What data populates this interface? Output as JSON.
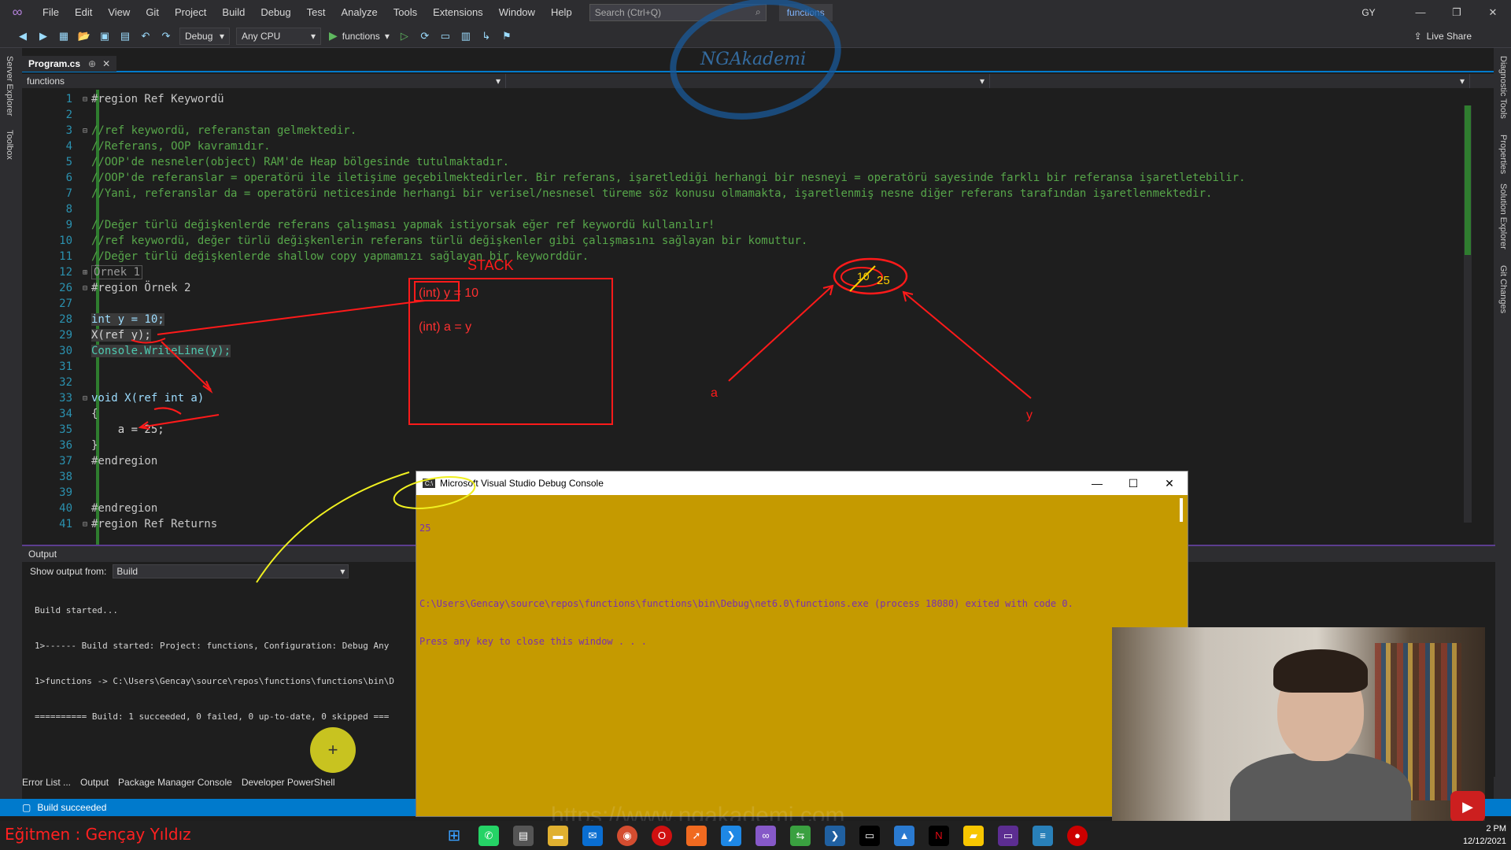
{
  "menubar": {
    "items": [
      "File",
      "Edit",
      "View",
      "Git",
      "Project",
      "Build",
      "Debug",
      "Test",
      "Analyze",
      "Tools",
      "Extensions",
      "Window",
      "Help"
    ],
    "search_placeholder": "Search (Ctrl+Q)",
    "solution_name": "functions",
    "user_initials": "GY"
  },
  "toolbar": {
    "config": "Debug",
    "platform": "Any CPU",
    "run_target": "functions",
    "live_share": "Live Share"
  },
  "side_tabs": {
    "left": [
      "Server Explorer",
      "Toolbox"
    ],
    "right": [
      "Diagnostic Tools",
      "Properties",
      "Solution Explorer",
      "Git Changes"
    ]
  },
  "document": {
    "tab_name": "Program.cs",
    "nav_scope": "functions"
  },
  "code_lines": [
    {
      "n": "1",
      "text": "#region Ref Keywordü",
      "kind": "region"
    },
    {
      "n": "2",
      "text": "",
      "kind": "plain"
    },
    {
      "n": "3",
      "text": "//ref keywordü, referanstan gelmektedir.",
      "kind": "comment"
    },
    {
      "n": "4",
      "text": "//Referans, OOP kavramıdır.",
      "kind": "comment"
    },
    {
      "n": "5",
      "text": "//OOP'de nesneler(object) RAM'de Heap bölgesinde tutulmaktadır.",
      "kind": "comment"
    },
    {
      "n": "6",
      "text": "//OOP'de referanslar = operatörü ile iletişime geçebilmektedirler. Bir referans, işaretlediği herhangi bir nesneyi = operatörü sayesinde farklı bir referansa işaretletebilir.",
      "kind": "comment"
    },
    {
      "n": "7",
      "text": "//Yani, referanslar da = operatörü neticesinde herhangi bir verisel/nesnesel türeme söz konusu olmamakta, işaretlenmiş nesne diğer referans tarafından işaretlenmektedir.",
      "kind": "comment"
    },
    {
      "n": "8",
      "text": "",
      "kind": "plain"
    },
    {
      "n": "9",
      "text": "//Değer türlü değişkenlerde referans çalışması yapmak istiyorsak eğer ref keywordü kullanılır!",
      "kind": "comment"
    },
    {
      "n": "10",
      "text": "//ref keywordü, değer türlü değişkenlerin referans türlü değişkenler gibi çalışmasını sağlayan bir komuttur.",
      "kind": "comment"
    },
    {
      "n": "11",
      "text": "//Değer türlü değişkenlerde shallow copy yapmamızı sağlayan bir keyworddür.",
      "kind": "comment"
    },
    {
      "n": "12",
      "text": "Örnek 1",
      "kind": "collapsed"
    },
    {
      "n": "26",
      "text": "#region Örnek 2",
      "kind": "region"
    },
    {
      "n": "27",
      "text": "",
      "kind": "plain"
    },
    {
      "n": "28",
      "text": "int y = 10;",
      "kind": "code-int"
    },
    {
      "n": "29",
      "text": "X(ref y);",
      "kind": "code-call"
    },
    {
      "n": "30",
      "text": "Console.WriteLine(y);",
      "kind": "code-console"
    },
    {
      "n": "31",
      "text": "",
      "kind": "plain"
    },
    {
      "n": "32",
      "text": "",
      "kind": "plain"
    },
    {
      "n": "33",
      "text": "void X(ref int a)",
      "kind": "code-void"
    },
    {
      "n": "34",
      "text": "{",
      "kind": "plain"
    },
    {
      "n": "35",
      "text": "    a = 25;",
      "kind": "plain"
    },
    {
      "n": "36",
      "text": "}",
      "kind": "plain"
    },
    {
      "n": "37",
      "text": "#endregion",
      "kind": "region"
    },
    {
      "n": "38",
      "text": "",
      "kind": "plain"
    },
    {
      "n": "39",
      "text": "",
      "kind": "plain"
    },
    {
      "n": "40",
      "text": "#endregion",
      "kind": "region"
    },
    {
      "n": "41",
      "text": "#region Ref Returns",
      "kind": "region"
    }
  ],
  "annotations": {
    "stack_label": "STACK",
    "stack_entry_1": "(int) y = 10",
    "stack_entry_2": "(int) a = y",
    "heap_value_old": "10",
    "heap_value_new": "25",
    "ref_a": "a",
    "ref_y": "y"
  },
  "output": {
    "title": "Output",
    "show_from_label": "Show output from:",
    "show_from_value": "Build",
    "lines": [
      "Build started...",
      "1>------ Build started: Project: functions, Configuration: Debug Any",
      "1>functions -> C:\\Users\\Gencay\\source\\repos\\functions\\functions\\bin\\D",
      "========== Build: 1 succeeded, 0 failed, 0 up-to-date, 0 skipped ==="
    ],
    "bottom_tabs": [
      "Error List ...",
      "Output",
      "Package Manager Console",
      "Developer PowerShell"
    ]
  },
  "status": {
    "text": "Build succeeded"
  },
  "console_window": {
    "title": "Microsoft Visual Studio Debug Console",
    "icon_label": "C:\\",
    "lines": [
      "25",
      "",
      "C:\\Users\\Gencay\\source\\repos\\functions\\functions\\bin\\Debug\\net6.0\\functions.exe (process 18080) exited with code 0.",
      "Press any key to close this window . . ."
    ]
  },
  "watermark": {
    "logo_text": "NGAkademi",
    "site": "https://www.ngakademi.com"
  },
  "instructor": "Eğitmen : Gençay Yıldız",
  "clock": {
    "time": "2 PM",
    "date": "12/12/2021"
  },
  "colors": {
    "accent": "#007acc",
    "console_bg": "#c59a00",
    "annotation_red": "#ff1a1a",
    "annotation_yellow": "#f0f020"
  }
}
